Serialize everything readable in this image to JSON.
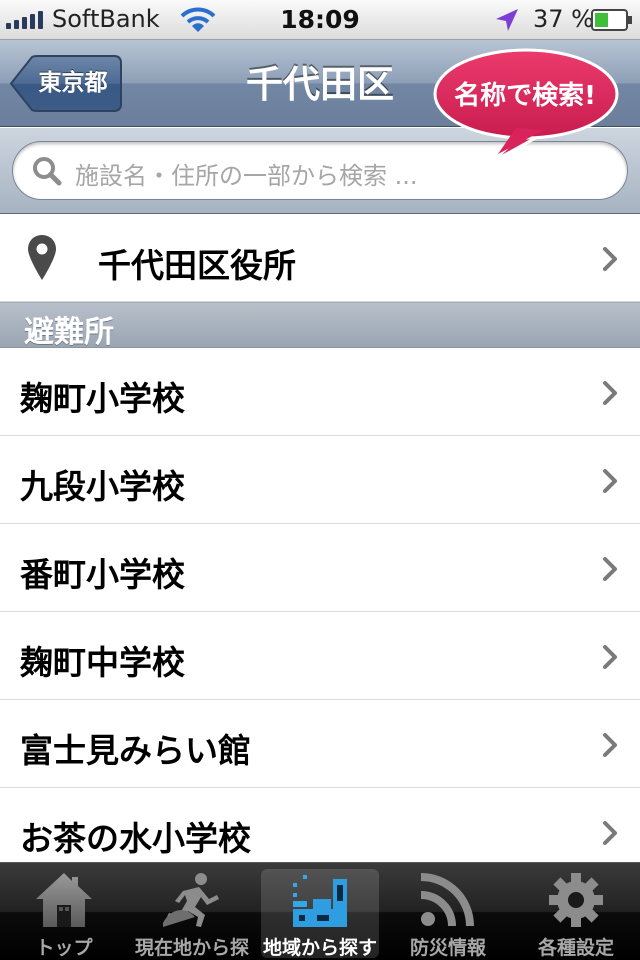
{
  "status_bar": {
    "carrier": "SoftBank",
    "time": "18:09",
    "battery": "37 %",
    "icons": [
      "signal-icon",
      "wifi-icon",
      "location-icon",
      "battery-icon"
    ]
  },
  "nav": {
    "back_label": "東京都",
    "title": "千代田区"
  },
  "callout": {
    "text": "名称で検索!",
    "color": "#d8245a"
  },
  "search": {
    "placeholder": "施設名・住所の一部から検索 ..."
  },
  "city_office": {
    "label": "千代田区役所",
    "icon": "map-pin-icon"
  },
  "section": {
    "header": "避難所"
  },
  "shelters": [
    {
      "label": "麹町小学校"
    },
    {
      "label": "九段小学校"
    },
    {
      "label": "番町小学校"
    },
    {
      "label": "麹町中学校"
    },
    {
      "label": "富士見みらい館"
    },
    {
      "label": "お茶の水小学校"
    }
  ],
  "tabs": [
    {
      "label": "トップ",
      "icon": "home-icon"
    },
    {
      "label": "現在地から探す",
      "icon": "running-person-icon"
    },
    {
      "label": "地域から探す",
      "icon": "area-icon",
      "active": true
    },
    {
      "label": "防災情報",
      "icon": "rss-icon"
    },
    {
      "label": "各種設定",
      "icon": "gear-icon"
    }
  ],
  "colors": {
    "nav_bar": "#7287a4",
    "tab_active_icon": "#33a8e8"
  }
}
